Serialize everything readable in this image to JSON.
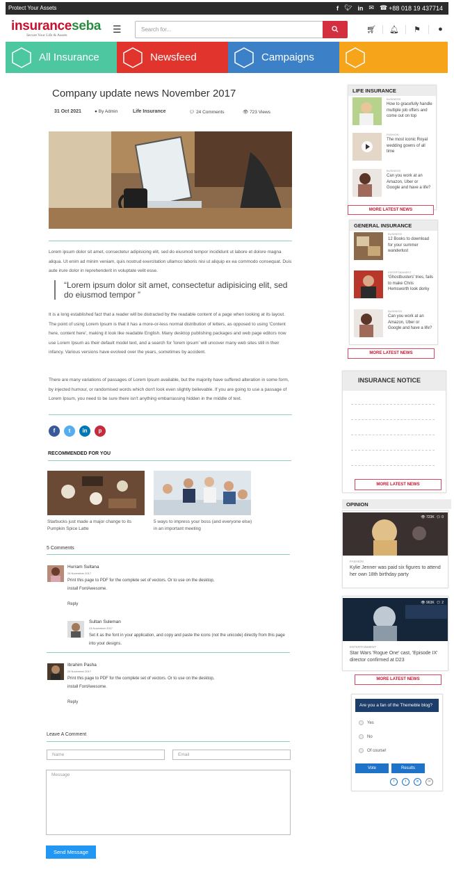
{
  "topbar": {
    "tagline": "Protect Your Assets",
    "phone": "+88 018 19 437714",
    "icons": [
      "facebook-icon",
      "twitter-icon",
      "linkedin-icon",
      "mail-icon",
      "phone-icon"
    ]
  },
  "header": {
    "brand_a": "insurance",
    "brand_b": "seba",
    "tagline": "Secure Your Life & Assets",
    "search_placeholder": "Search for..."
  },
  "nav": [
    {
      "label": "All Insurance",
      "color": "#4dc7a0"
    },
    {
      "label": "Newsfeed",
      "color": "#e0342c"
    },
    {
      "label": "Campaigns",
      "color": "#3c80c8"
    },
    {
      "label": "",
      "color": "#f6a51a"
    }
  ],
  "article": {
    "title": "Company update news November 2017",
    "date": "31 Oct 2021",
    "author": "By Admin",
    "category": "Life Insurance",
    "comments": "24 Comments",
    "views": "723 Views",
    "p1": "Lorem ipsum dolor sit amet, consectetur adipisicing elit, sed do eiusmod tempor incididunt ut labore et dolore magna aliqua. Ut enim ad minim veniam, quis nostrud exercitation ullamco laboris nisi ut aliquip ex ea commodo consequat. Duis aute irure dolor in reprehenderit in voluptate velit esse.",
    "quote": "“Lorem ipsum dolor sit amet, consectetur adipisicing elit, sed do eiusmod tempor ”",
    "p2": "It is a long established fact that a reader will be distracted by the readable content of a page when looking at its layout. The point of using Lorem Ipsum is that it has a more-or-less normal distribution of letters, as opposed to using 'Content here, content here', making it look like readable English. Many desktop publishing packages and web page editors now use Lorem Ipsum as their default model text, and a search for 'lorem ipsum' will uncover many web sites still in their infancy. Various versions have evolved over the years, sometimes by accident.",
    "p3": "There are many variations of passages of Lorem Ipsum available, but the majority have suffered alteration in some form, by injected humour, or randomised words which don't look even slightly believable. If you are going to use a passage of Lorem Ipsum, you need to be sure there isn't anything embarrassing hidden in the middle of text."
  },
  "recommended": {
    "heading": "RECOMMENDED FOR YOU",
    "items": [
      {
        "caption": "Starbucks just made a major change to its Pumpkin Spice Latte"
      },
      {
        "caption": "5 ways to impress your boss (and everyone else) in an important meeting"
      }
    ]
  },
  "comments": {
    "heading": "5 Comments",
    "items": [
      {
        "name": "Hurram Sultana",
        "date": "24 November 2017",
        "text": "Print this page to PDF for the complete set of vectors. Or to use on the desktop, install FontAwesome.",
        "reply": "Reply"
      },
      {
        "name": "Sultan Suleman",
        "date": "24 November 2017",
        "text": "Set it as the font in your application, and copy and paste the icons (not the unicode) directly from this page into your designs."
      },
      {
        "name": "Ibrahim Pasha",
        "date": "24 November 2017",
        "text": "Print this page to PDF for the complete set of vectors. Or to use on the desktop, install FontAwesome.",
        "reply": "Reply"
      }
    ]
  },
  "form": {
    "heading": "Leave A Comment",
    "name": "Name",
    "email": "Email",
    "message": "Message",
    "send": "Send Message"
  },
  "sidebar": {
    "life": {
      "heading": "LIFE INSURANCE",
      "items": [
        {
          "cat": "BUSINESS",
          "title": "How to gracefully handle multiple job offers and come out on top"
        },
        {
          "cat": "FASHION",
          "title": "The most iconic Royal wedding gowns of all time"
        },
        {
          "cat": "BUSINESS",
          "title": "Can you work at an Amazon, Uber or Google and have a life?"
        }
      ],
      "more": "MORE LATEST NEWS"
    },
    "general": {
      "heading": "GENERAL INSURANCE",
      "items": [
        {
          "cat": "BUSINESS",
          "title": "12 Books to download for your summer wanderlust"
        },
        {
          "cat": "ENTERTAINMENT",
          "title": "'Ghostbusters' tries, fails to make Chris Hemsworth look dorky"
        },
        {
          "cat": "BUSINESS",
          "title": "Can you work at an Amazon, Uber or Google and have a life?"
        }
      ],
      "more": "MORE LATEST NEWS"
    },
    "notice": {
      "heading": "INSURANCE NOTICE",
      "more": "MORE LATEST NEWS"
    },
    "opinion": {
      "heading": "OPINION",
      "items": [
        {
          "cat": "FASHION",
          "title": "Kylie Jenner was paid six figures to attend her own 18th birthday party",
          "views": "723K",
          "comments": "0"
        },
        {
          "cat": "ENTERTAINMENT",
          "title": "Star Wars 'Rogue One' cast, 'Episode IX' director confirmed at D23",
          "views": "963K",
          "comments": "2"
        }
      ],
      "more": "MORE LATEST NEWS"
    },
    "poll": {
      "question": "Are you a fan of the Themeble blog?",
      "options": [
        "Yes",
        "No",
        "Of course!"
      ],
      "vote": "Vote",
      "results": "Results"
    }
  }
}
